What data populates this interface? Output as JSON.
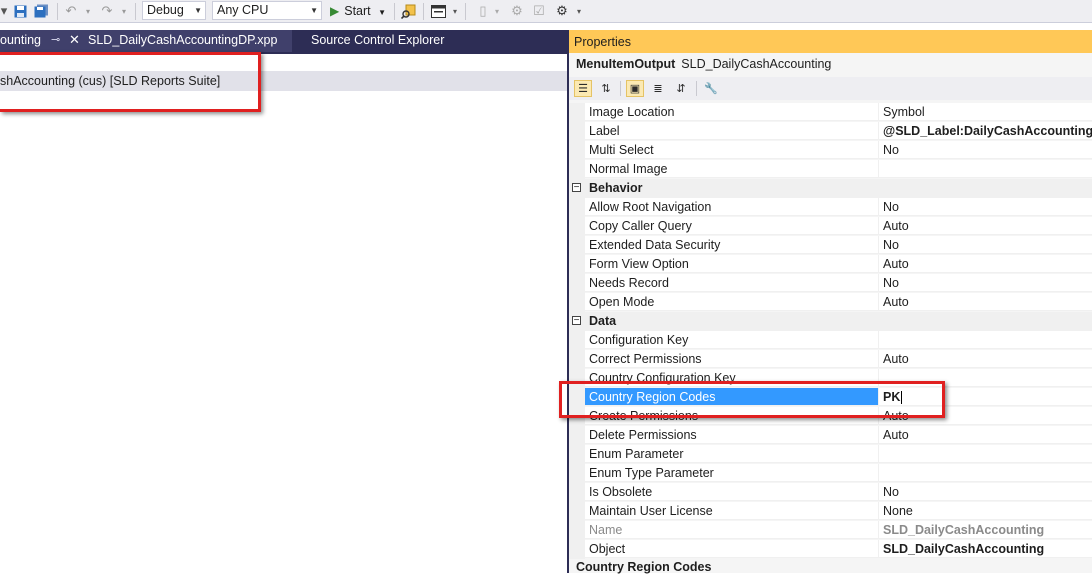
{
  "toolbar": {
    "config": "Debug",
    "platform": "Any CPU",
    "start": "Start",
    "colors": {
      "background": "#eeeef2",
      "start_icon": "#388a34"
    }
  },
  "tabs": {
    "active": "ounting",
    "second": "SLD_DailyCashAccountingDP.xpp",
    "third": "Source Control Explorer"
  },
  "tree": {
    "node": "shAccounting (cus) [SLD Reports Suite]"
  },
  "properties": {
    "title": "Properties",
    "object_type": "MenuItemOutput",
    "object_name": "SLD_DailyCashAccounting",
    "title_color": "#ffc857",
    "selection_color": "#3399ff",
    "rows": [
      {
        "name": "Image Location",
        "value": "Symbol"
      },
      {
        "name": "Label",
        "value": "@SLD_Label:DailyCashAccounting",
        "bold": true
      },
      {
        "name": "Multi Select",
        "value": "No"
      },
      {
        "name": "Normal Image",
        "value": ""
      },
      {
        "category": "Behavior"
      },
      {
        "name": "Allow Root Navigation",
        "value": "No"
      },
      {
        "name": "Copy Caller Query",
        "value": "Auto"
      },
      {
        "name": "Extended Data Security",
        "value": "No"
      },
      {
        "name": "Form View Option",
        "value": "Auto"
      },
      {
        "name": "Needs Record",
        "value": "No"
      },
      {
        "name": "Open Mode",
        "value": "Auto"
      },
      {
        "category": "Data"
      },
      {
        "name": "Configuration Key",
        "value": ""
      },
      {
        "name": "Correct Permissions",
        "value": "Auto"
      },
      {
        "name": "Country Configuration Key",
        "value": ""
      },
      {
        "name": "Country Region Codes",
        "value": "PK",
        "selected": true
      },
      {
        "name": "Create Permissions",
        "value": "Auto"
      },
      {
        "name": "Delete Permissions",
        "value": "Auto"
      },
      {
        "name": "Enum Parameter",
        "value": ""
      },
      {
        "name": "Enum Type Parameter",
        "value": ""
      },
      {
        "name": "Is Obsolete",
        "value": "No"
      },
      {
        "name": "Maintain User License",
        "value": "None"
      },
      {
        "name": "Name",
        "value": "SLD_DailyCashAccounting",
        "readonly": true,
        "bold": true
      },
      {
        "name": "Object",
        "value": "SLD_DailyCashAccounting",
        "bold": true
      }
    ],
    "footer": "Country Region Codes"
  },
  "annotation_color": "#e02020"
}
